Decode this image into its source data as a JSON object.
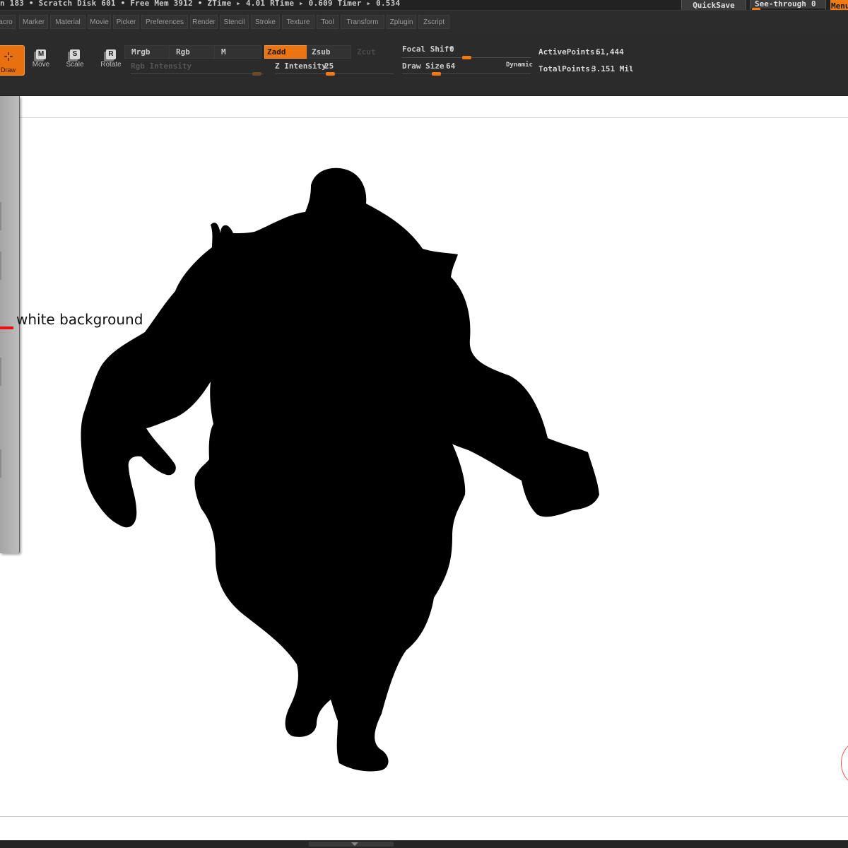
{
  "status_bar": {
    "text": "n 183 • Scratch Disk 601 • Free Mem 3912 • ZTime ▸ 4.01  RTime ▸ 0.609  Timer ▸ 0.534",
    "quicksave": "QuickSave",
    "see_through_label": "See-through",
    "see_through_value": "0",
    "menus_label": "Menus"
  },
  "menu": {
    "items": [
      "acro",
      "Marker",
      "Material",
      "Movie",
      "Picker",
      "Preferences",
      "Render",
      "Stencil",
      "Stroke",
      "Texture",
      "Tool",
      "Transform",
      "Zplugin",
      "Zscript"
    ]
  },
  "toolbar": {
    "draw": "Draw",
    "move": {
      "label": "Move",
      "glyph": "M"
    },
    "scale": {
      "label": "Scale",
      "glyph": "S"
    },
    "rotate": {
      "label": "Rotate",
      "glyph": "R"
    },
    "mrgb": "Mrgb",
    "rgb": "Rgb",
    "m": "M",
    "zadd": "Zadd",
    "zsub": "Zsub",
    "zcut": "Zcut",
    "rgb_intensity": "Rgb Intensity",
    "z_intensity_label": "Z Intensity",
    "z_intensity_value": "25",
    "z_intensity_level": 0.25,
    "focal_shift_label": "Focal Shift",
    "focal_shift_value": "0",
    "draw_size_label": "Draw Size",
    "draw_size_value": "64",
    "dynamic": "Dynamic",
    "active_points_label": "ActivePoints:",
    "active_points_value": "61,444",
    "total_points_label": "TotalPoints:",
    "total_points_value": "3.151 Mil"
  },
  "canvas": {
    "annotation": "white background",
    "accent": "#f07a14",
    "marker_color": "#ee1010"
  },
  "icons": [
    "draw-icon",
    "move-icon",
    "scale-icon",
    "rotate-icon"
  ]
}
